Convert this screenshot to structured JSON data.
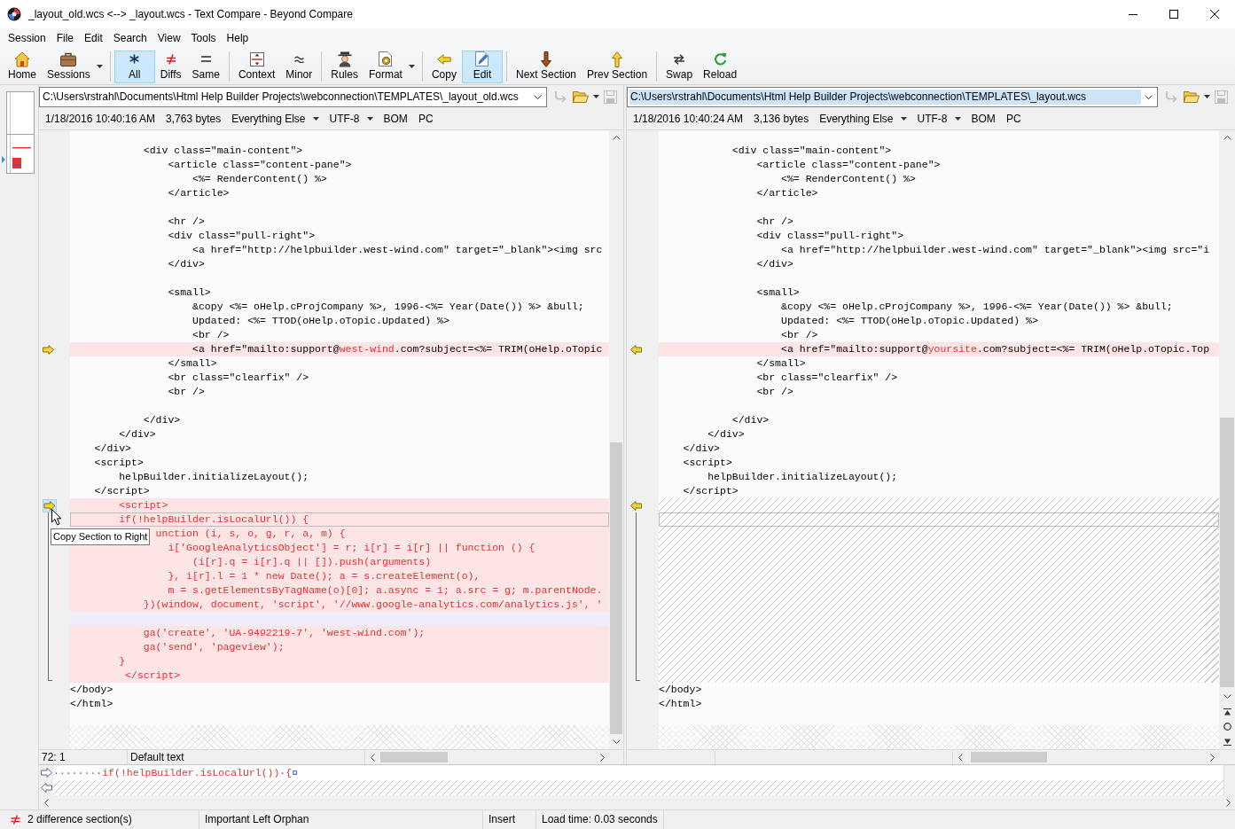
{
  "window": {
    "title": "_layout_old.wcs <--> _layout.wcs - Text Compare - Beyond Compare"
  },
  "menu": [
    "Session",
    "File",
    "Edit",
    "Search",
    "View",
    "Tools",
    "Help"
  ],
  "toolbar": [
    {
      "items": [
        {
          "label": "Home",
          "pressed": false
        },
        {
          "label": "Sessions",
          "pressed": false,
          "dropdown": true
        }
      ]
    },
    {
      "items": [
        {
          "label": "All",
          "pressed": true
        },
        {
          "label": "Diffs",
          "pressed": false
        },
        {
          "label": "Same",
          "pressed": false
        }
      ]
    },
    {
      "items": [
        {
          "label": "Context",
          "pressed": false
        },
        {
          "label": "Minor",
          "pressed": false
        }
      ]
    },
    {
      "items": [
        {
          "label": "Rules",
          "pressed": false
        },
        {
          "label": "Format",
          "pressed": false,
          "dropdown": true
        }
      ]
    },
    {
      "items": [
        {
          "label": "Copy",
          "pressed": false
        },
        {
          "label": "Edit",
          "pressed": true
        }
      ]
    },
    {
      "items": [
        {
          "label": "Next Section",
          "pressed": false
        },
        {
          "label": "Prev Section",
          "pressed": false
        }
      ]
    },
    {
      "items": [
        {
          "label": "Swap",
          "pressed": false
        },
        {
          "label": "Reload",
          "pressed": false
        }
      ]
    }
  ],
  "panes": [
    {
      "path": "C:\\Users\\rstrahl\\Documents\\Html Help Builder Projects\\webconnection\\TEMPLATES\\_layout_old.wcs",
      "text_selected": false,
      "tools": [
        {
          "disabled": true
        },
        {
          "disabled": false,
          "dropdown": true
        },
        {
          "disabled": true
        }
      ],
      "info": [
        {
          "text": "1/18/2016 10:40:16 AM"
        },
        {
          "text": "3,763 bytes"
        },
        {
          "text": "Everything Else",
          "dropdown": true
        },
        {
          "text": "UTF-8",
          "dropdown": true
        },
        {
          "text": "BOM"
        },
        {
          "text": "PC"
        }
      ],
      "lines": [
        {
          "kind": "same",
          "text": "            <div class=\"main-content\">",
          "current": false
        },
        {
          "kind": "same",
          "text": "                <article class=\"content-pane\">",
          "current": false
        },
        {
          "kind": "same",
          "text": "                    <%= RenderContent() %>",
          "current": false
        },
        {
          "kind": "same",
          "text": "                </article>",
          "current": false
        },
        {
          "kind": "same",
          "current": false
        },
        {
          "kind": "same",
          "text": "                <hr />",
          "current": false
        },
        {
          "kind": "same",
          "text": "                <div class=\"pull-right\">",
          "current": false
        },
        {
          "kind": "same",
          "text": "                    <a href=\"http://helpbuilder.west-wind.com\" target=\"_blank\"><img src",
          "current": false
        },
        {
          "kind": "same",
          "text": "                </div>",
          "current": false
        },
        {
          "kind": "same",
          "current": false
        },
        {
          "kind": "same",
          "text": "                <small>",
          "current": false
        },
        {
          "kind": "same",
          "text": "                    &copy <%= oHelp.cProjCompany %>, 1996-<%= Year(Date()) %> &bull;",
          "current": false
        },
        {
          "kind": "same",
          "text": "                    Updated: <%= TTOD(oHelp.oTopic.Updated) %>",
          "current": false
        },
        {
          "kind": "same",
          "text": "                    <br />",
          "current": false
        },
        {
          "kind": "changed",
          "segments": [
            {
              "text": "                    <a href=\"mailto:support@",
              "diff": false
            },
            {
              "text": "west-wind",
              "diff": true
            },
            {
              "text": ".com?subject=<%= TRIM(oHelp.oTopic",
              "diff": false
            }
          ],
          "current": false,
          "marker": {
            "hovered": false
          }
        },
        {
          "kind": "same",
          "text": "                </small>",
          "current": false
        },
        {
          "kind": "same",
          "text": "                <br class=\"clearfix\" />",
          "current": false
        },
        {
          "kind": "same",
          "text": "                <br />",
          "current": false
        },
        {
          "kind": "same",
          "current": false
        },
        {
          "kind": "same",
          "text": "            </div>",
          "current": false
        },
        {
          "kind": "same",
          "text": "        </div>",
          "current": false
        },
        {
          "kind": "same",
          "text": "    </div>",
          "current": false
        },
        {
          "kind": "same",
          "text": "    <script>",
          "current": false
        },
        {
          "kind": "same",
          "text": "        helpBuilder.initializeLayout();",
          "current": false
        },
        {
          "kind": "same",
          "text": "    </script>",
          "current": false
        },
        {
          "kind": "orphan",
          "text": "        <script>",
          "current": false,
          "marker": {
            "hovered": true,
            "tooltip": "Copy Section to Right"
          }
        },
        {
          "kind": "orphan",
          "text": "        if(!helpBuilder.isLocalUrl()) {",
          "current": true
        },
        {
          "kind": "orphan",
          "text": "              unction (i, s, o, g, r, a, m) {",
          "current": false
        },
        {
          "kind": "orphan",
          "text": "                i['GoogleAnalyticsObject'] = r; i[r] = i[r] || function () {",
          "current": false
        },
        {
          "kind": "orphan",
          "text": "                    (i[r].q = i[r].q || []).push(arguments)",
          "current": false
        },
        {
          "kind": "orphan",
          "text": "                }, i[r].l = 1 * new Date(); a = s.createElement(o),",
          "current": false
        },
        {
          "kind": "orphan",
          "text": "                m = s.getElementsByTagName(o)[0]; a.async = 1; a.src = g; m.parentNode.",
          "current": false
        },
        {
          "kind": "orphan",
          "text": "            })(window, document, 'script', '//www.google-analytics.com/analytics.js', '",
          "current": false
        },
        {
          "kind": "orphan-blank",
          "current": false
        },
        {
          "kind": "orphan",
          "text": "            ga('create', 'UA-9492219-7', 'west-wind.com');",
          "current": false
        },
        {
          "kind": "orphan",
          "text": "            ga('send', 'pageview');",
          "current": false
        },
        {
          "kind": "orphan",
          "text": "        }",
          "current": false
        },
        {
          "kind": "orphan",
          "text": "         </script>",
          "current": false
        },
        {
          "kind": "same",
          "text": "</body>",
          "current": false
        },
        {
          "kind": "same",
          "text": "</html>",
          "current": false
        }
      ],
      "status": [
        "72: 1",
        "Default text"
      ]
    },
    {
      "path": "C:\\Users\\rstrahl\\Documents\\Html Help Builder Projects\\webconnection\\TEMPLATES\\_layout.wcs",
      "text_selected": true,
      "tools": [
        {
          "disabled": true
        },
        {
          "disabled": false,
          "dropdown": true
        },
        {
          "disabled": true
        }
      ],
      "info": [
        {
          "text": "1/18/2016 10:40:24 AM"
        },
        {
          "text": "3,136 bytes"
        },
        {
          "text": "Everything Else",
          "dropdown": true
        },
        {
          "text": "UTF-8",
          "dropdown": true
        },
        {
          "text": "BOM"
        },
        {
          "text": "PC"
        }
      ],
      "lines": [
        {
          "kind": "same",
          "text": "            <div class=\"main-content\">",
          "current": false
        },
        {
          "kind": "same",
          "text": "                <article class=\"content-pane\">",
          "current": false
        },
        {
          "kind": "same",
          "text": "                    <%= RenderContent() %>",
          "current": false
        },
        {
          "kind": "same",
          "text": "                </article>",
          "current": false
        },
        {
          "kind": "same",
          "current": false
        },
        {
          "kind": "same",
          "text": "                <hr />",
          "current": false
        },
        {
          "kind": "same",
          "text": "                <div class=\"pull-right\">",
          "current": false
        },
        {
          "kind": "same",
          "text": "                    <a href=\"http://helpbuilder.west-wind.com\" target=\"_blank\"><img src=\"i",
          "current": false
        },
        {
          "kind": "same",
          "text": "                </div>",
          "current": false
        },
        {
          "kind": "same",
          "current": false
        },
        {
          "kind": "same",
          "text": "                <small>",
          "current": false
        },
        {
          "kind": "same",
          "text": "                    &copy <%= oHelp.cProjCompany %>, 1996-<%= Year(Date()) %> &bull;",
          "current": false
        },
        {
          "kind": "same",
          "text": "                    Updated: <%= TTOD(oHelp.oTopic.Updated) %>",
          "current": false
        },
        {
          "kind": "same",
          "text": "                    <br />",
          "current": false
        },
        {
          "kind": "changed",
          "segments": [
            {
              "text": "                    <a href=\"mailto:support@",
              "diff": false
            },
            {
              "text": "yoursite",
              "diff": true
            },
            {
              "text": ".com?subject=<%= TRIM(oHelp.oTopic.Top",
              "diff": false
            }
          ],
          "current": false,
          "marker": {
            "hovered": false
          }
        },
        {
          "kind": "same",
          "text": "                </small>",
          "current": false
        },
        {
          "kind": "same",
          "text": "                <br class=\"clearfix\" />",
          "current": false
        },
        {
          "kind": "same",
          "text": "                <br />",
          "current": false
        },
        {
          "kind": "same",
          "current": false
        },
        {
          "kind": "same",
          "text": "            </div>",
          "current": false
        },
        {
          "kind": "same",
          "text": "        </div>",
          "current": false
        },
        {
          "kind": "same",
          "text": "    </div>",
          "current": false
        },
        {
          "kind": "same",
          "text": "    <script>",
          "current": false
        },
        {
          "kind": "same",
          "text": "        helpBuilder.initializeLayout();",
          "current": false
        },
        {
          "kind": "same",
          "text": "    </script>",
          "current": false
        },
        {
          "kind": "gap",
          "current": false,
          "marker": {
            "hovered": false
          }
        },
        {
          "kind": "gap",
          "current": true
        },
        {
          "kind": "gap",
          "current": false
        },
        {
          "kind": "gap",
          "current": false
        },
        {
          "kind": "gap",
          "current": false
        },
        {
          "kind": "gap",
          "current": false
        },
        {
          "kind": "gap",
          "current": false
        },
        {
          "kind": "gap",
          "current": false
        },
        {
          "kind": "gap",
          "current": false
        },
        {
          "kind": "gap",
          "current": false
        },
        {
          "kind": "gap",
          "current": false
        },
        {
          "kind": "gap",
          "current": false
        },
        {
          "kind": "gap",
          "current": false
        },
        {
          "kind": "same",
          "text": "</body>",
          "current": false
        },
        {
          "kind": "same",
          "text": "</html>",
          "current": false
        }
      ]
    }
  ],
  "line_details": [
    {
      "kind": "text",
      "segments": [
        {
          "kind": "space",
          "text": "········"
        },
        {
          "kind": "code",
          "text": "if(!helpBuilder.isLocalUrl())"
        },
        {
          "kind": "space",
          "text": "·"
        },
        {
          "kind": "code",
          "text": "{"
        },
        {
          "kind": "eol",
          "text": "¤"
        }
      ]
    },
    {
      "kind": "gap"
    }
  ],
  "status_bar": [
    "2 difference section(s)",
    "Important Left Orphan",
    "Insert",
    "Load time: 0.03 seconds"
  ]
}
